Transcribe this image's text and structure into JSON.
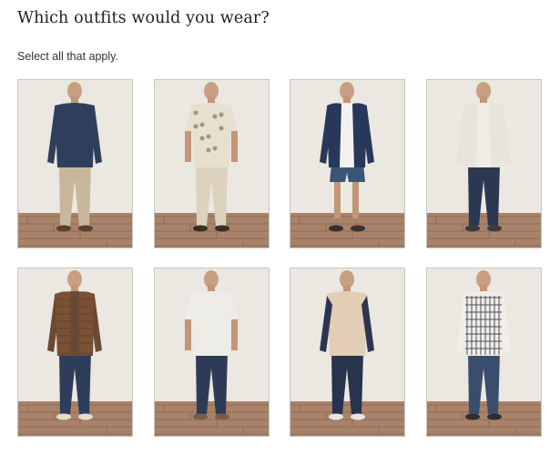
{
  "header": {
    "title": "Which outfits would you wear?",
    "subtitle": "Select all that apply."
  },
  "outfits": [
    {
      "id": 1,
      "icon": "outfit-photo",
      "shirt": "#2e3f5c",
      "pants": "#c9b79c",
      "shoes": "#5a4030",
      "layer": "",
      "style": "longsleeve"
    },
    {
      "id": 2,
      "icon": "outfit-photo",
      "shirt": "#e7dfcf",
      "pants": "#ddd2be",
      "shoes": "#3a2d24",
      "layer": "",
      "style": "shortsleeve"
    },
    {
      "id": 3,
      "icon": "outfit-photo",
      "shirt": "#f4f2ee",
      "pants": "#3b5576",
      "shoes": "#3a3030",
      "layer": "#27385a",
      "style": "hoodie-shorts"
    },
    {
      "id": 4,
      "icon": "outfit-photo",
      "shirt": "#f1ede6",
      "pants": "#2c3852",
      "shoes": "#3b3b3b",
      "layer": "#e9e4da",
      "style": "hoodie"
    },
    {
      "id": 5,
      "icon": "outfit-photo",
      "shirt": "#6b4a34",
      "pants": "#2e3d5a",
      "shoes": "#e5dccb",
      "layer": "#7a5233",
      "style": "vest"
    },
    {
      "id": 6,
      "icon": "outfit-photo",
      "shirt": "#eeece6",
      "pants": "#2d3b56",
      "shoes": "#7a5d45",
      "layer": "",
      "style": "shortsleeve"
    },
    {
      "id": 7,
      "icon": "outfit-photo",
      "shirt": "#e2cdb5",
      "pants": "#26344e",
      "shoes": "#e9e6e0",
      "layer": "#2c3550",
      "style": "raglan"
    },
    {
      "id": 8,
      "icon": "outfit-photo",
      "shirt": "#f1eee8",
      "pants": "#3b4d6c",
      "shoes": "#2f2f33",
      "layer": "",
      "style": "plaid"
    }
  ]
}
